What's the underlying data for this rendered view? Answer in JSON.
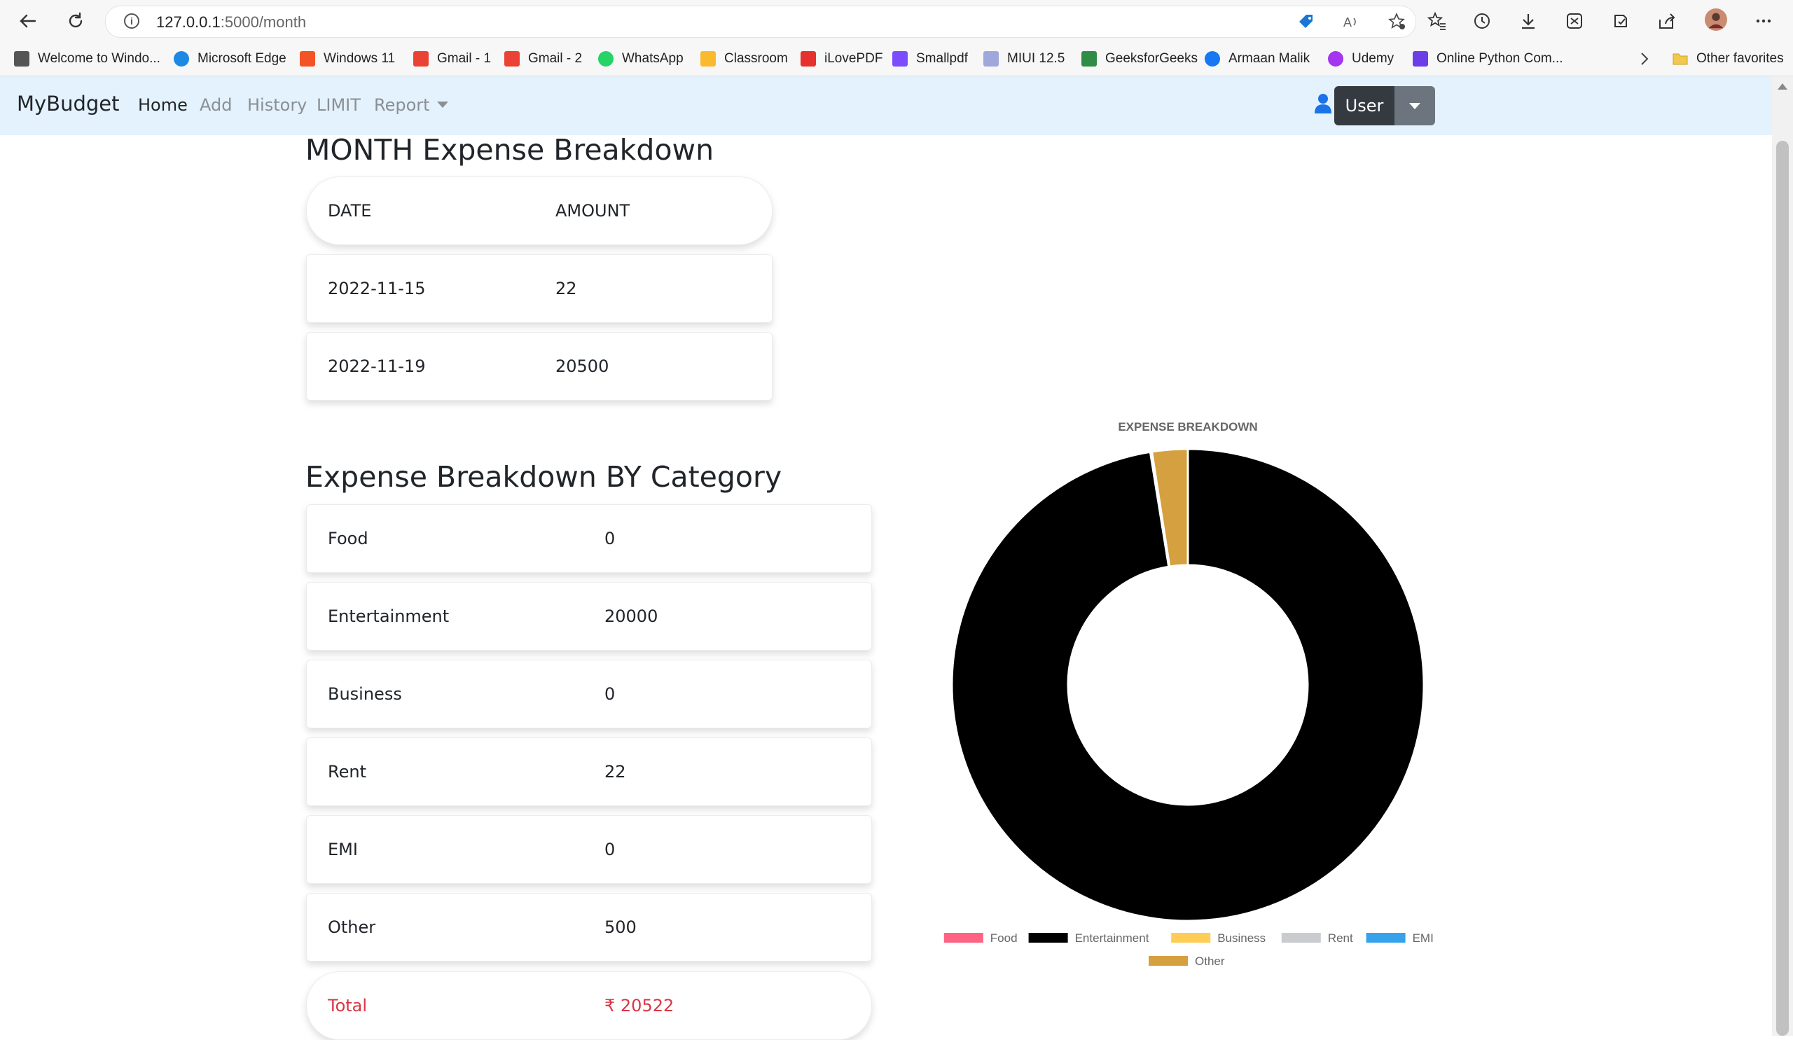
{
  "browser": {
    "url_host": "127.0.0.1",
    "url_path": ":5000/month",
    "bookmarks": [
      {
        "label": "Welcome to Windo...",
        "icon": "page-icon",
        "color": "#555555"
      },
      {
        "label": "Microsoft Edge",
        "icon": "edge-icon",
        "color": "#1e88e5"
      },
      {
        "label": "Windows 11",
        "icon": "windows-icon",
        "color": "#f35325"
      },
      {
        "label": "Gmail - 1",
        "icon": "gmail-icon",
        "color": "#ea4335"
      },
      {
        "label": "Gmail - 2",
        "icon": "gmail-icon",
        "color": "#ea4335"
      },
      {
        "label": "WhatsApp",
        "icon": "whatsapp-icon",
        "color": "#25d366"
      },
      {
        "label": "Classroom",
        "icon": "classroom-icon",
        "color": "#f9bb2d"
      },
      {
        "label": "iLovePDF",
        "icon": "ilovepdf-icon",
        "color": "#e5322d"
      },
      {
        "label": "Smallpdf",
        "icon": "smallpdf-icon",
        "color": "#7c4dff"
      },
      {
        "label": "MIUI 12.5",
        "icon": "miui-icon",
        "color": "#9fa8da"
      },
      {
        "label": "GeeksforGeeks",
        "icon": "gfg-icon",
        "color": "#2f8d46"
      },
      {
        "label": "Armaan Malik",
        "icon": "facebook-icon",
        "color": "#1877f2"
      },
      {
        "label": "Udemy",
        "icon": "udemy-icon",
        "color": "#a435f0"
      },
      {
        "label": "Online Python Com...",
        "icon": "python-icon",
        "color": "#6c3ee8"
      }
    ],
    "other_favorites": "Other favorites"
  },
  "navbar": {
    "brand": "MyBudget",
    "links": [
      "Home",
      "Add",
      "History",
      "LIMIT",
      "Report"
    ],
    "user_label": "User"
  },
  "month": {
    "title": "MONTH Expense Breakdown",
    "header": {
      "date": "DATE",
      "amount": "AMOUNT"
    },
    "rows": [
      {
        "date": "2022-11-15",
        "amount": "22"
      },
      {
        "date": "2022-11-19",
        "amount": "20500"
      }
    ]
  },
  "category": {
    "title": "Expense Breakdown BY Category",
    "rows": [
      {
        "name": "Food",
        "amount": "0"
      },
      {
        "name": "Entertainment",
        "amount": "20000"
      },
      {
        "name": "Business",
        "amount": "0"
      },
      {
        "name": "Rent",
        "amount": "22"
      },
      {
        "name": "EMI",
        "amount": "0"
      },
      {
        "name": "Other",
        "amount": "500"
      }
    ],
    "total_label": "Total",
    "total_value": "₹ 20522"
  },
  "chart_data": {
    "type": "doughnut",
    "title": "EXPENSE BREAKDOWN",
    "categories": [
      "Food",
      "Entertainment",
      "Business",
      "Rent",
      "EMI",
      "Other"
    ],
    "values": [
      0,
      20000,
      0,
      22,
      0,
      500
    ],
    "colors": [
      "#ff6384",
      "#000000",
      "#ffcd56",
      "#c9cbcf",
      "#36a2eb",
      "#d4a040"
    ],
    "legend_position": "bottom"
  }
}
